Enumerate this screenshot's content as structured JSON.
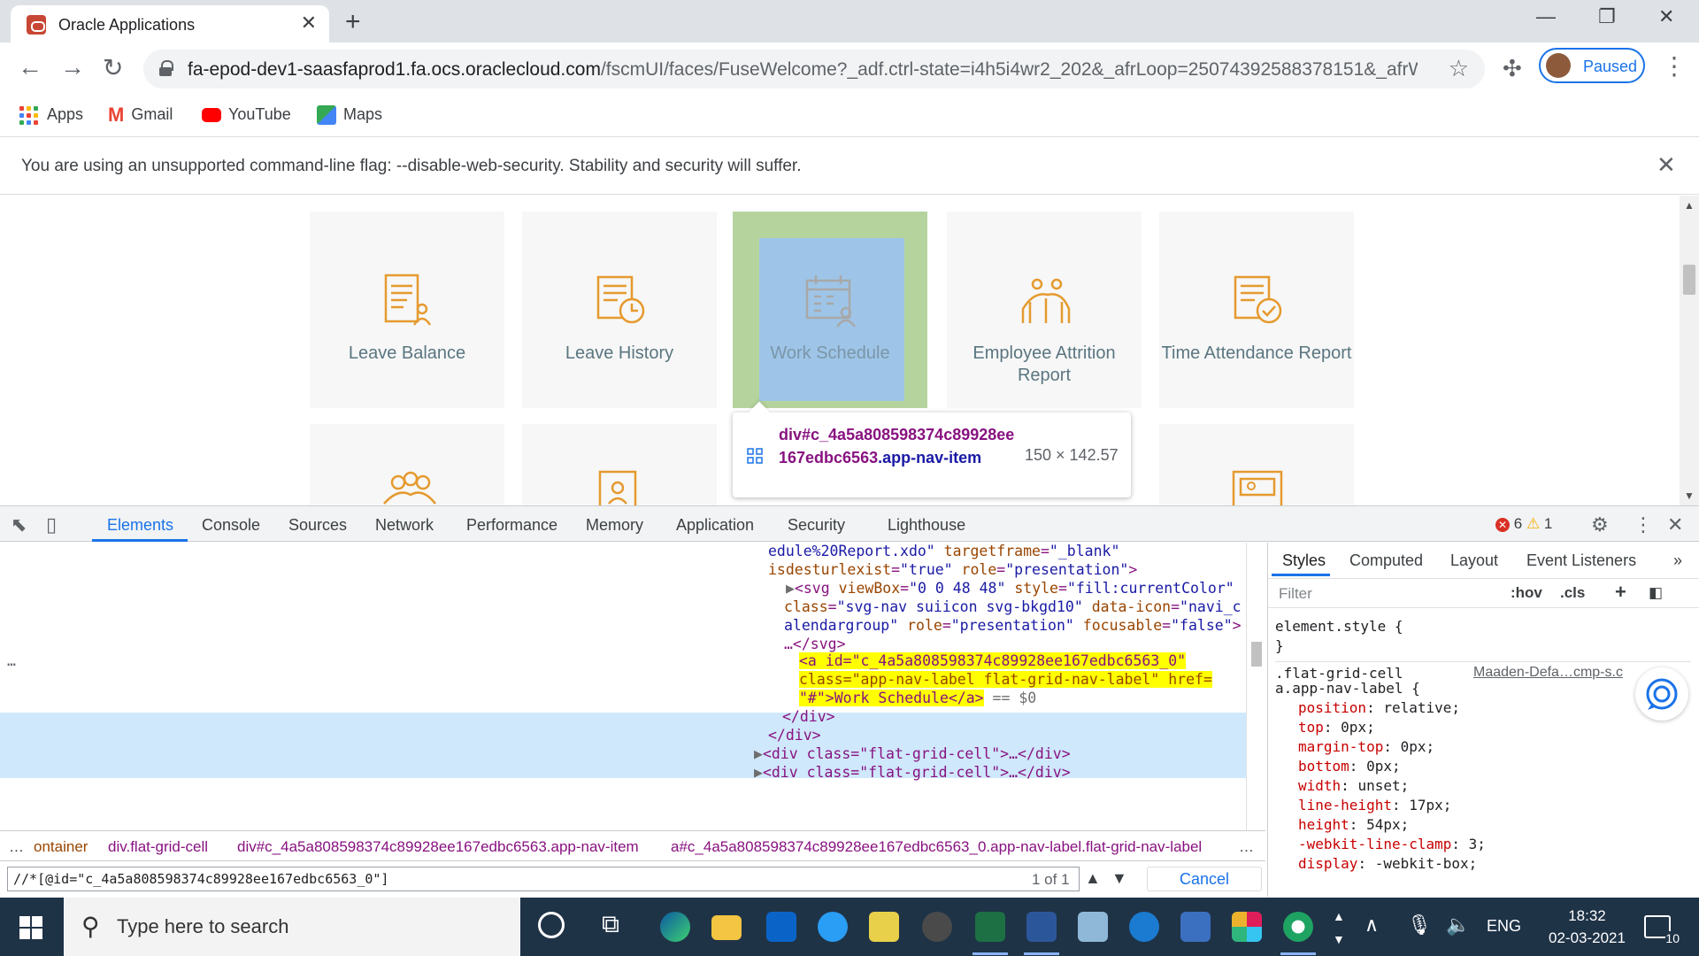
{
  "browser": {
    "tab_title": "Oracle Applications",
    "url_host": "fa-epod-dev1-saasfaprod1.fa.ocs.oraclecloud.com",
    "url_path": "/fscmUI/faces/FuseWelcome?_adf.ctrl-state=i4h5i4wr2_202&_afrLoop=25074392588378151&_afrWi...",
    "profile_label": "Paused",
    "bookmarks": [
      {
        "label": "Apps",
        "icon": "apps-grid-icon"
      },
      {
        "label": "Gmail",
        "icon": "gmail-icon"
      },
      {
        "label": "YouTube",
        "icon": "youtube-icon"
      },
      {
        "label": "Maps",
        "icon": "maps-icon"
      }
    ],
    "infobar_message": "You are using an unsupported command-line flag: --disable-web-security. Stability and security will suffer."
  },
  "tiles": [
    {
      "label": "Leave Balance",
      "icon": "document-person-icon"
    },
    {
      "label": "Leave History",
      "icon": "document-clock-icon"
    },
    {
      "label": "Work Schedule",
      "icon": "calendar-group-icon",
      "selected": true
    },
    {
      "label": "Employee Attrition Report",
      "icon": "people-chart-icon"
    },
    {
      "label": "Time Attendance Report",
      "icon": "document-check-icon"
    }
  ],
  "tooltip": {
    "selector_tag": "div",
    "selector_id": "#c_4a5a808598374c89928ee167edbc6563",
    "selector_class": ".app-nav-item",
    "dimensions": "150 × 142.57"
  },
  "devtools": {
    "tabs": [
      "Elements",
      "Console",
      "Sources",
      "Network",
      "Performance",
      "Memory",
      "Application",
      "Security",
      "Lighthouse"
    ],
    "active_tab": "Elements",
    "error_count": "6",
    "warning_count": "1",
    "dom_lines": {
      "l1_val": "edule%20Report.xdo\"",
      "l1_attr": " targetframe",
      "l1_val2": "\"_blank\"",
      "l2_attr": "isdesturlexist",
      "l2_val": "\"true\"",
      "l2_attr2": " role",
      "l2_val2": "\"presentation\"",
      "l3_tag": "<svg",
      "l3_attr": " viewBox",
      "l3_val": "\"0 0 48 48\"",
      "l3_attr2": " style",
      "l3_val2": "\"fill:currentColor\"",
      "l4_attr": "class",
      "l4_val": "\"svg-nav suiicon svg-bkgd10\"",
      "l4_attr2": " data-icon",
      "l4_val2": "\"navi_c",
      "l5_val": "alendargroup\"",
      "l5_attr": " role",
      "l5_val2": "\"presentation\"",
      "l5_attr2": " focusable",
      "l5_val3": "\"false\"",
      "l6": "…</svg>",
      "sel1": "<a id=\"c_4a5a808598374c89928ee167edbc6563_0\"",
      "sel2": "class=\"app-nav-label flat-grid-nav-label\" href=",
      "sel3": "\"#\">Work Schedule</a>",
      "sel_eq": " == $0",
      "l_close1": "</div>",
      "l_close2": "</div>",
      "l_cell1": "<div class=\"flat-grid-cell\">…</div>",
      "l_cell2": "<div class=\"flat-grid-cell\">…</div>",
      "ellipsis": "…"
    },
    "breadcrumbs": [
      {
        "label": "ontainer",
        "prefix": ""
      },
      {
        "label": "div.flat-grid-cell",
        "prefix": ""
      },
      {
        "label": "div#c_4a5a808598374c89928ee167edbc6563.app-nav-item",
        "prefix": ""
      },
      {
        "label": "a#c_4a5a808598374c89928ee167edbc6563_0.app-nav-label.flat-grid-nav-label",
        "prefix": ""
      }
    ],
    "search_query": "//*[@id=\"c_4a5a808598374c89928ee167edbc6563_0\"]",
    "search_count": "1 of 1",
    "cancel_label": "Cancel",
    "styles_tabs": [
      "Styles",
      "Computed",
      "Layout",
      "Event Listeners"
    ],
    "filter_placeholder": "Filter",
    "hov_label": ":hov",
    "cls_label": ".cls",
    "css_element_style": "element.style {",
    "css_close": "}",
    "css_selector1": ".flat-grid-cell",
    "css_selector2": "a.app-nav-label {",
    "css_source": "Maaden-Defa…cmp-s.c",
    "css_props": [
      {
        "name": "position",
        "value": "relative;"
      },
      {
        "name": "top",
        "value": "0px;"
      },
      {
        "name": "margin-top",
        "value": "0px;"
      },
      {
        "name": "bottom",
        "value": "0px;"
      },
      {
        "name": "width",
        "value": "unset;"
      },
      {
        "name": "line-height",
        "value": "17px;"
      },
      {
        "name": "height",
        "value": "54px;"
      },
      {
        "name": "-webkit-line-clamp",
        "value": "3;"
      },
      {
        "name": "display",
        "value": "-webkit-box;"
      }
    ]
  },
  "taskbar": {
    "search_placeholder": "Type here to search",
    "language": "ENG",
    "time": "18:32",
    "date": "02-03-2021",
    "notification_count": "10"
  }
}
